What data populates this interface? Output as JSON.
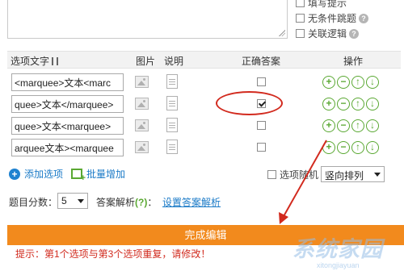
{
  "top": {
    "textarea_text": "",
    "side_options": [
      {
        "label": "填写提示",
        "checked": false,
        "help": false
      },
      {
        "label": "无条件跳题",
        "checked": false,
        "help": true
      },
      {
        "label": "关联逻辑",
        "checked": false,
        "help": true
      }
    ],
    "help_glyph": "?"
  },
  "table": {
    "headers": {
      "option_text": "选项文字",
      "image": "图片",
      "note": "说明",
      "correct": "正确答案",
      "actions": "操作"
    },
    "rows": [
      {
        "value": "<marquee>文本<marc",
        "correct": false
      },
      {
        "value": "quee>文本</marquee>",
        "correct": true
      },
      {
        "value": "quee>文本<marquee>",
        "correct": false
      },
      {
        "value": "arquee文本><marquee",
        "correct": false
      }
    ],
    "op_glyphs": [
      "+",
      "−",
      "↑",
      "↓"
    ]
  },
  "add_bar": {
    "add_option": "添加选项",
    "batch_add": "批量增加",
    "random_label": "选项随机",
    "arrangement": "竖向排列",
    "plus_glyph": "+"
  },
  "score": {
    "label": "题目分数：",
    "value": "5",
    "analysis_label": "答案解析",
    "analysis_hint": "(?)",
    "analysis_sep": "：",
    "set_analysis": "设置答案解析"
  },
  "finish_button": "完成编辑",
  "warning": "提示：第1个选项与第3个选项重复，请修改！",
  "watermark": {
    "main": "系统家园",
    "sub": "xitongjiayuan"
  },
  "colors": {
    "accent_orange": "#f28a1d",
    "warning_red": "#d12a1e",
    "op_green": "#5aa832",
    "link_blue": "#1a7ac7"
  }
}
